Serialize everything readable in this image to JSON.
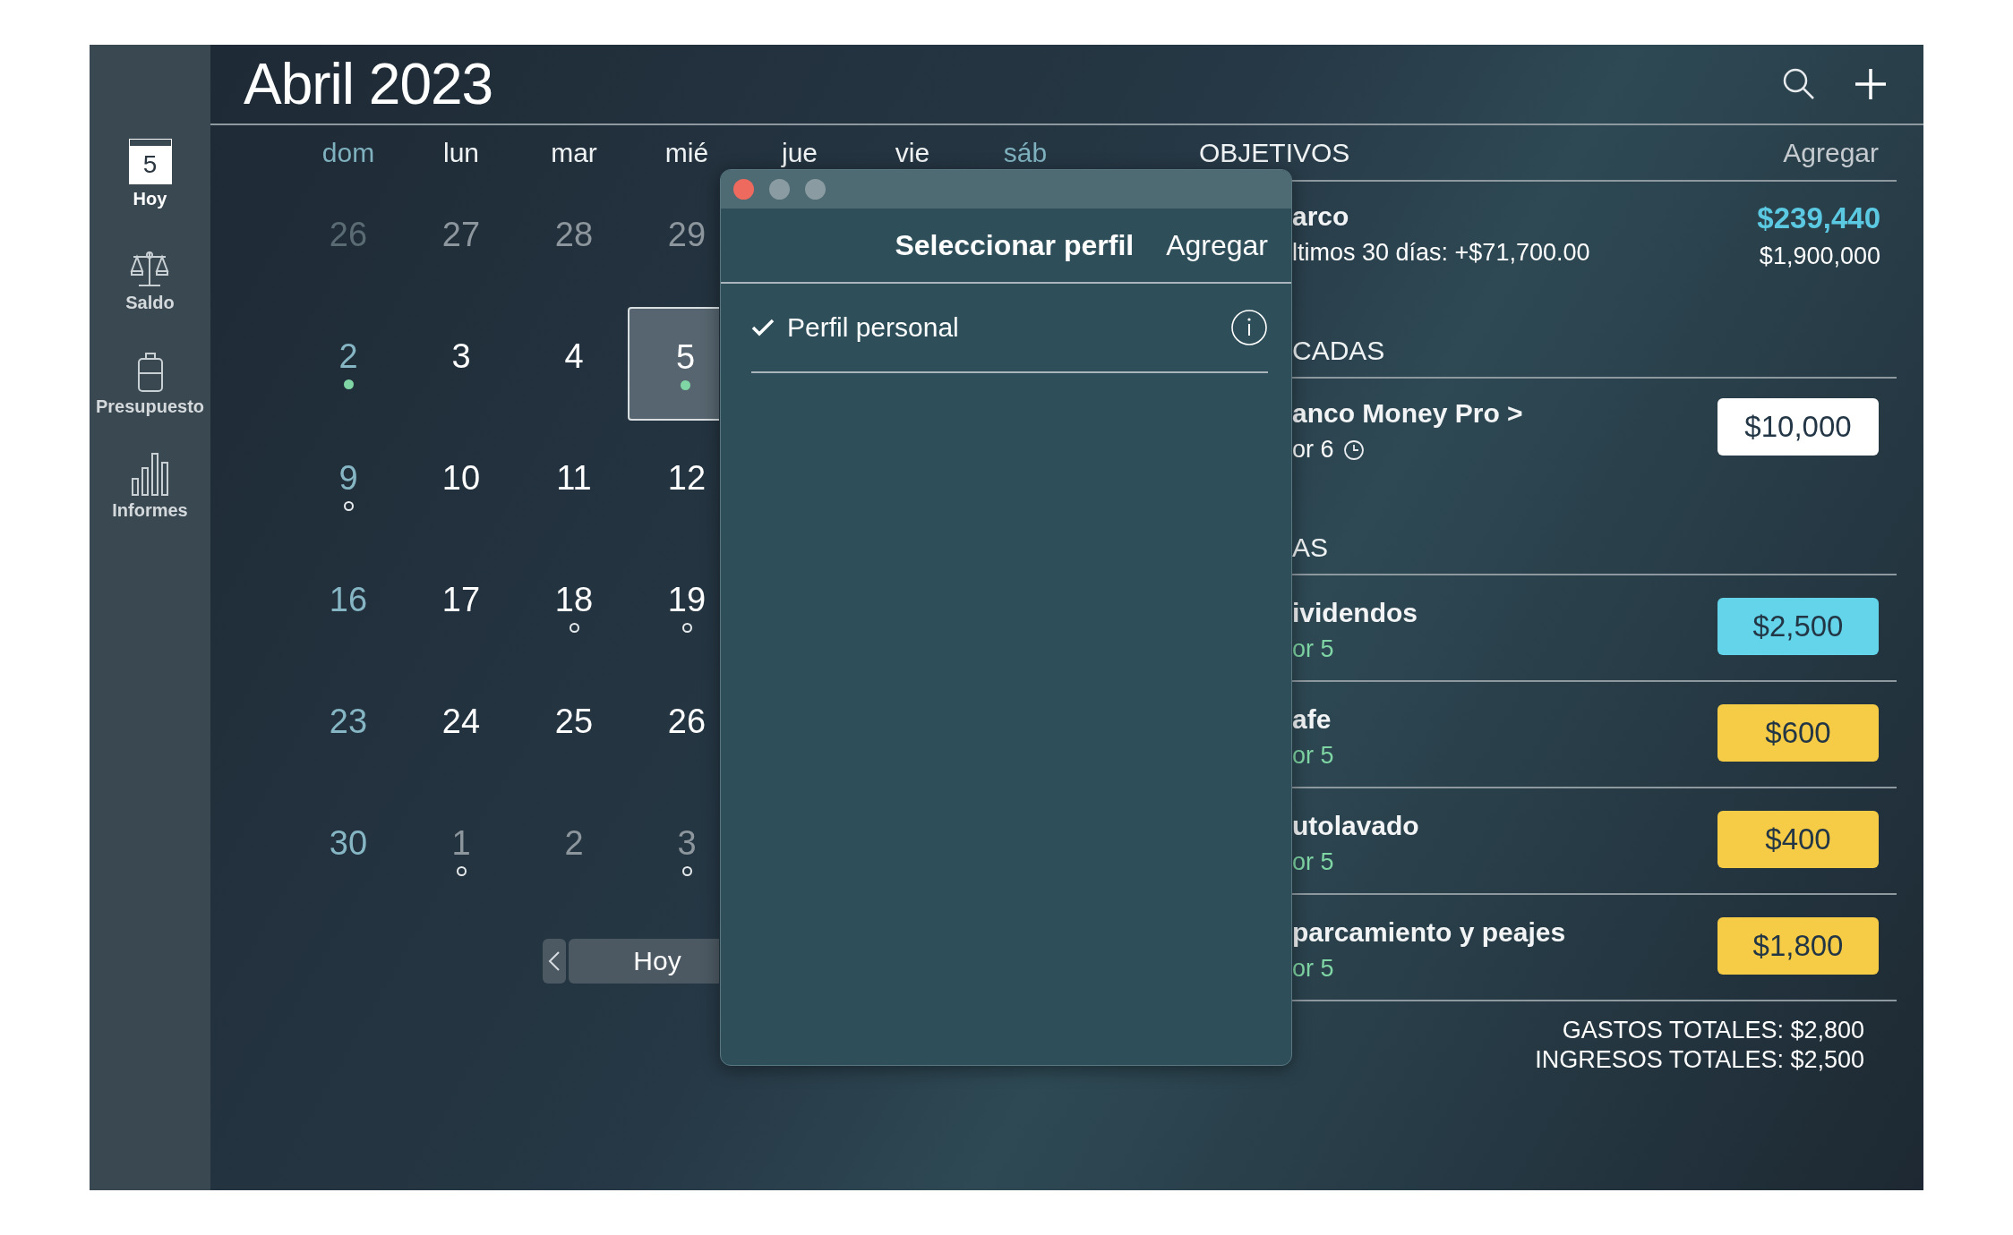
{
  "sidebar": {
    "items": [
      {
        "label": "Hoy",
        "badge": "5",
        "selected": true
      },
      {
        "label": "Saldo",
        "selected": false
      },
      {
        "label": "Presupuesto",
        "selected": false
      },
      {
        "label": "Informes",
        "selected": false
      }
    ]
  },
  "title": "**Abril** 2023",
  "calendar": {
    "weekdays": [
      {
        "label": "dom",
        "weekend": true
      },
      {
        "label": "lun",
        "weekend": false
      },
      {
        "label": "mar",
        "weekend": false
      },
      {
        "label": "mié",
        "weekend": false
      },
      {
        "label": "jue",
        "weekend": false
      },
      {
        "label": "vie",
        "weekend": false
      },
      {
        "label": "sáb",
        "weekend": true
      }
    ],
    "weeks": [
      [
        {
          "day": "26",
          "outside": true,
          "weekend": true,
          "dot": false,
          "selected": false
        },
        {
          "day": "27",
          "outside": true,
          "weekend": false,
          "dot": false,
          "selected": false
        },
        {
          "day": "28",
          "outside": true,
          "weekend": false,
          "dot": false,
          "selected": false
        },
        {
          "day": "29",
          "outside": true,
          "weekend": false,
          "dot": false,
          "selected": false
        }
      ],
      [
        {
          "day": "2",
          "outside": false,
          "weekend": true,
          "dot": true,
          "dot_filled": true,
          "selected": false
        },
        {
          "day": "3",
          "outside": false,
          "weekend": false,
          "dot": false,
          "selected": false
        },
        {
          "day": "4",
          "outside": false,
          "weekend": false,
          "dot": false,
          "selected": false
        },
        {
          "day": "5",
          "outside": false,
          "weekend": false,
          "dot": true,
          "dot_filled": true,
          "selected": true
        }
      ],
      [
        {
          "day": "9",
          "outside": false,
          "weekend": true,
          "dot": true,
          "dot_filled": false,
          "selected": false
        },
        {
          "day": "10",
          "outside": false,
          "weekend": false,
          "dot": false,
          "selected": false
        },
        {
          "day": "11",
          "outside": false,
          "weekend": false,
          "dot": false,
          "selected": false
        },
        {
          "day": "12",
          "outside": false,
          "weekend": false,
          "dot": false,
          "selected": false
        }
      ],
      [
        {
          "day": "16",
          "outside": false,
          "weekend": true,
          "dot": false,
          "selected": false
        },
        {
          "day": "17",
          "outside": false,
          "weekend": false,
          "dot": false,
          "selected": false
        },
        {
          "day": "18",
          "outside": false,
          "weekend": false,
          "dot": true,
          "dot_filled": false,
          "selected": false
        },
        {
          "day": "19",
          "outside": false,
          "weekend": false,
          "dot": true,
          "dot_filled": false,
          "selected": false
        }
      ],
      [
        {
          "day": "23",
          "outside": false,
          "weekend": true,
          "dot": false,
          "selected": false
        },
        {
          "day": "24",
          "outside": false,
          "weekend": false,
          "dot": false,
          "selected": false
        },
        {
          "day": "25",
          "outside": false,
          "weekend": false,
          "dot": false,
          "selected": false
        },
        {
          "day": "26",
          "outside": false,
          "weekend": false,
          "dot": false,
          "selected": false
        }
      ],
      [
        {
          "day": "30",
          "outside": false,
          "weekend": true,
          "dot": false,
          "selected": false
        },
        {
          "day": "1",
          "outside": true,
          "weekend": false,
          "dot": true,
          "dot_filled": false,
          "selected": false
        },
        {
          "day": "2",
          "outside": true,
          "weekend": false,
          "dot": false,
          "selected": false
        },
        {
          "day": "3",
          "outside": true,
          "weekend": false,
          "dot": true,
          "dot_filled": false,
          "selected": false
        }
      ]
    ],
    "today_button": "Hoy"
  },
  "panel": {
    "heading": "OBJETIVOS",
    "add": "Agregar",
    "goal": {
      "name": "arco",
      "change": "ltimos 30 días: +$71,700.00",
      "saved": "$239,440",
      "target": "$1,900,000"
    },
    "sections": [
      {
        "heading": "CADAS",
        "rows": [
          {
            "kind": "scheduled",
            "name": "anco Money Pro >",
            "sub": "or 6",
            "amount": "$10,000",
            "color": "#ffffff"
          }
        ]
      },
      {
        "heading": "AS",
        "rows": [
          {
            "kind": "budget",
            "name": "ividendos",
            "sub": "or 5",
            "amount": "$2,500",
            "color": "#64d4ea"
          },
          {
            "kind": "budget",
            "name": "afe",
            "sub": "or 5",
            "amount": "$600",
            "color": "#f6cb45"
          },
          {
            "kind": "budget",
            "name": "utolavado",
            "sub": "or 5",
            "amount": "$400",
            "color": "#f6cb45"
          },
          {
            "kind": "budget",
            "name": "parcamiento y peajes",
            "sub": "or 5",
            "amount": "$1,800",
            "color": "#f6cb45"
          }
        ]
      }
    ],
    "totals": [
      "GASTOS TOTALES: $2,800",
      "INGRESOS TOTALES: $2,500"
    ]
  },
  "dialog": {
    "title": "Seleccionar perfil",
    "add": "Agregar",
    "profiles": [
      {
        "name": "Perfil personal",
        "selected": true
      }
    ]
  }
}
